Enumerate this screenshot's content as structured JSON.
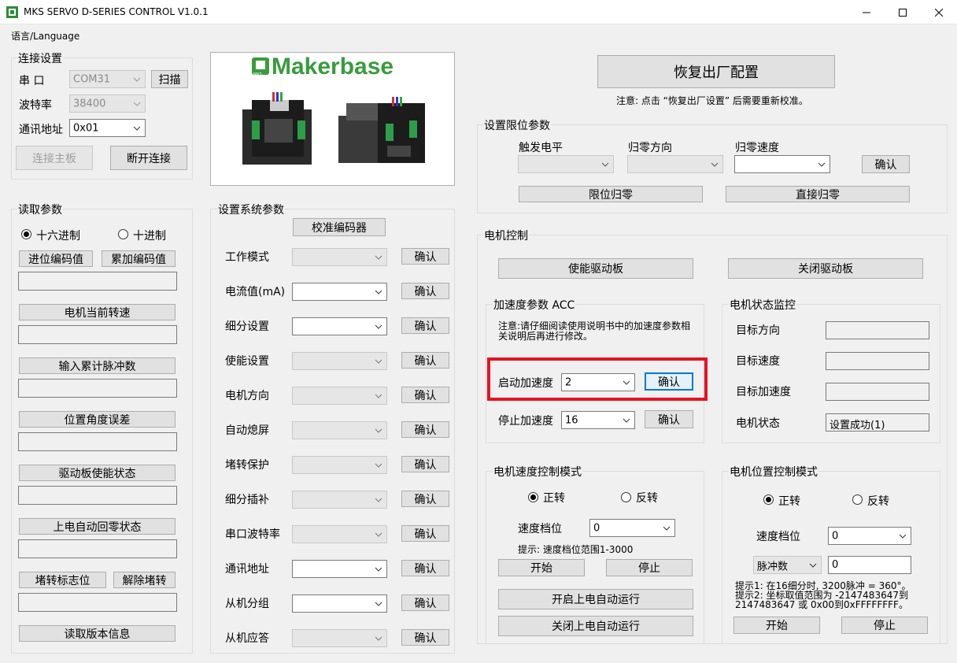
{
  "window": {
    "title": "MKS SERVO D-SERIES CONTROL V1.0.1"
  },
  "menu": {
    "language": "语言/Language"
  },
  "connection": {
    "title": "连接设置",
    "port_label": "串  口",
    "port_value": "COM31",
    "scan_button": "扫描",
    "baud_label": "波特率",
    "baud_value": "38400",
    "addr_label": "通讯地址",
    "addr_value": "0x01",
    "connect_button": "连接主板",
    "disconnect_button": "断开连接"
  },
  "logo": {
    "brand": "Makerbase",
    "badge": "MKS"
  },
  "factory": {
    "reset_button": "恢复出厂配置",
    "note": "注意: 点击 “恢复出厂设置” 后需要重新校准。"
  },
  "limit": {
    "title": "设置限位参数",
    "trigger_label": "触发电平",
    "home_dir_label": "归零方向",
    "home_speed_label": "归零速度",
    "confirm": "确认",
    "limit_home_button": "限位归零",
    "direct_home_button": "直接归零"
  },
  "read_params": {
    "title": "读取参数",
    "hex_label": "十六进制",
    "dec_label": "十进制",
    "hex_selected": true,
    "carry_button": "进位编码值",
    "accum_button": "累加编码值",
    "speed_button": "电机当前转速",
    "pulses_button": "输入累计脉冲数",
    "angle_err_button": "位置角度误差",
    "enable_state_button": "驱动板使能状态",
    "power_home_button": "上电自动回零状态",
    "stall_flag_button": "堵转标志位",
    "release_stall_button": "解除堵转",
    "version_button": "读取版本信息"
  },
  "sys_params": {
    "title": "设置系统参数",
    "calibrate_button": "校准编码器",
    "confirm": "确认",
    "rows": [
      {
        "label": "工作模式",
        "disabled": true
      },
      {
        "label": "电流值(mA)",
        "disabled": false
      },
      {
        "label": "细分设置",
        "disabled": false
      },
      {
        "label": "使能设置",
        "disabled": true
      },
      {
        "label": "电机方向",
        "disabled": true
      },
      {
        "label": "自动熄屏",
        "disabled": true
      },
      {
        "label": "堵转保护",
        "disabled": true
      },
      {
        "label": "细分插补",
        "disabled": true
      },
      {
        "label": "串口波特率",
        "disabled": true
      },
      {
        "label": "通讯地址",
        "disabled": false
      },
      {
        "label": "从机分组",
        "disabled": false
      },
      {
        "label": "从机应答",
        "disabled": true
      }
    ]
  },
  "motor_control": {
    "title": "电机控制",
    "enable_button": "使能驱动板",
    "disable_button": "关闭驱动板"
  },
  "acc": {
    "title": "加速度参数 ACC",
    "note": "注意:请仔细阅读使用说明书中的加速度参数相关说明后再进行修改。",
    "start_label": "启动加速度",
    "start_value": "2",
    "stop_label": "停止加速度",
    "stop_value": "16",
    "confirm": "确认"
  },
  "monitor": {
    "title": "电机状态监控",
    "target_dir": "目标方向",
    "target_speed": "目标速度",
    "target_acc": "目标加速度",
    "motor_state": "电机状态",
    "state_value": "设置成功(1)"
  },
  "speed_mode": {
    "title": "电机速度控制模式",
    "forward": "正转",
    "reverse": "反转",
    "gear_label": "速度档位",
    "gear_value": "0",
    "hint": "提示: 速度档位范围1-3000",
    "start_button": "开始",
    "stop_button": "停止",
    "auto_on_button": "开启上电自动运行",
    "auto_off_button": "关闭上电自动运行"
  },
  "pos_mode": {
    "title": "电机位置控制模式",
    "forward": "正转",
    "reverse": "反转",
    "gear_label": "速度档位",
    "gear_value": "0",
    "pulse_select": "脉冲数",
    "pulse_value": "0",
    "hint1": "提示1: 在16细分时, 3200脉冲 = 360°。",
    "hint2": "提示2: 坐标取值范围为 -2147483647到",
    "hint3": "2147483647 或 0x00到0xFFFFFFFF。",
    "start_button": "开始",
    "stop_button": "停止"
  }
}
